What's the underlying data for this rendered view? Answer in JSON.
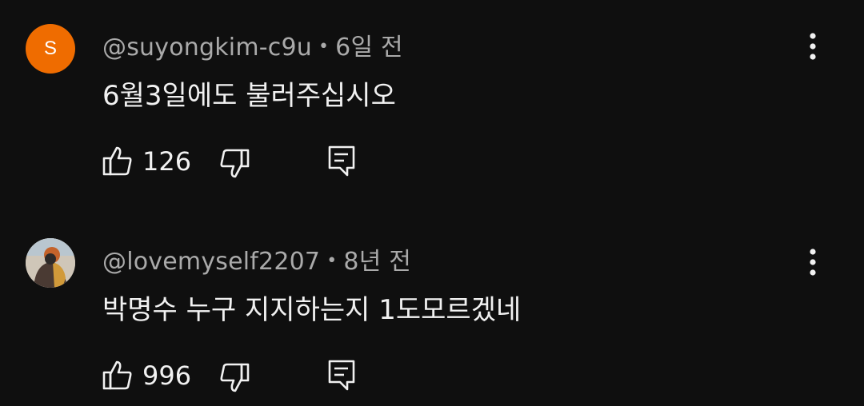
{
  "comments": [
    {
      "author": "@suyongkim-c9u",
      "age": "6일 전",
      "avatar_letter": "S",
      "avatar_color": "#ef6c00",
      "text": "6월3일에도 불러주십시오",
      "likes": "126"
    },
    {
      "author": "@lovemyself2207",
      "age": "8년 전",
      "text": "박명수 누구 지지하는지 1도모르겠네",
      "likes": "996"
    }
  ],
  "icons": {
    "like": "thumbs-up-icon",
    "dislike": "thumbs-down-icon",
    "reply": "reply-comment-icon",
    "menu": "more-vert-icon"
  },
  "theme": {
    "background": "#0f0f0f",
    "text": "#f1f1f1",
    "meta": "#aaaaaa"
  }
}
